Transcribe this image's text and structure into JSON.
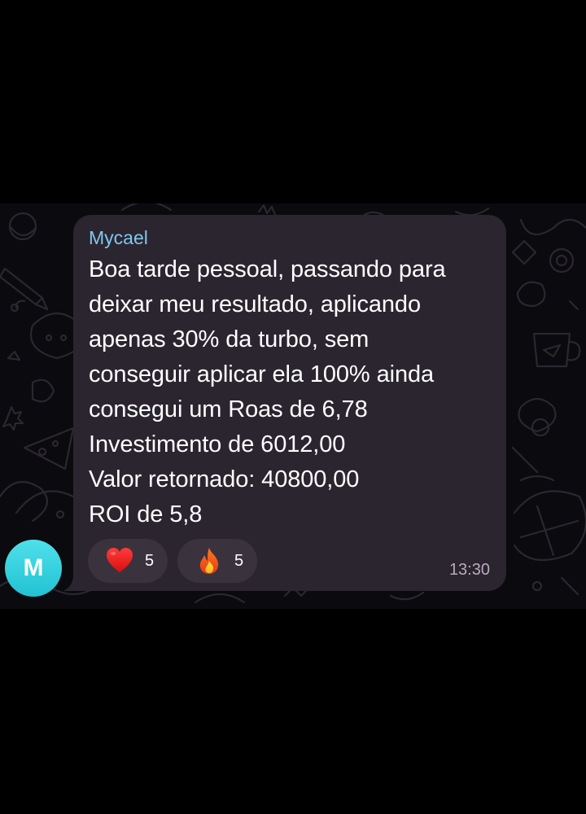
{
  "message": {
    "sender": "Mycael",
    "lines": [
      "Boa tarde pessoal, passando para",
      "deixar meu resultado, aplicando",
      "apenas 30% da turbo, sem",
      "conseguir aplicar ela 100% ainda",
      "consegui um Roas de 6,78",
      "Investimento de 6012,00",
      "Valor retornado: 40800,00",
      "ROI de 5,8"
    ],
    "time": "13:30"
  },
  "reactions": [
    {
      "emoji": "heart-icon",
      "count": "5"
    },
    {
      "emoji": "fire-icon",
      "count": "5"
    }
  ],
  "avatar": {
    "initial": "M",
    "color": "#2fcfdd"
  },
  "colors": {
    "background": "#000000",
    "chat_wallpaper": "#0b0a0e",
    "bubble": "#2b2530",
    "sender_name": "#7fc7ee",
    "timestamp": "#b7acbc"
  }
}
